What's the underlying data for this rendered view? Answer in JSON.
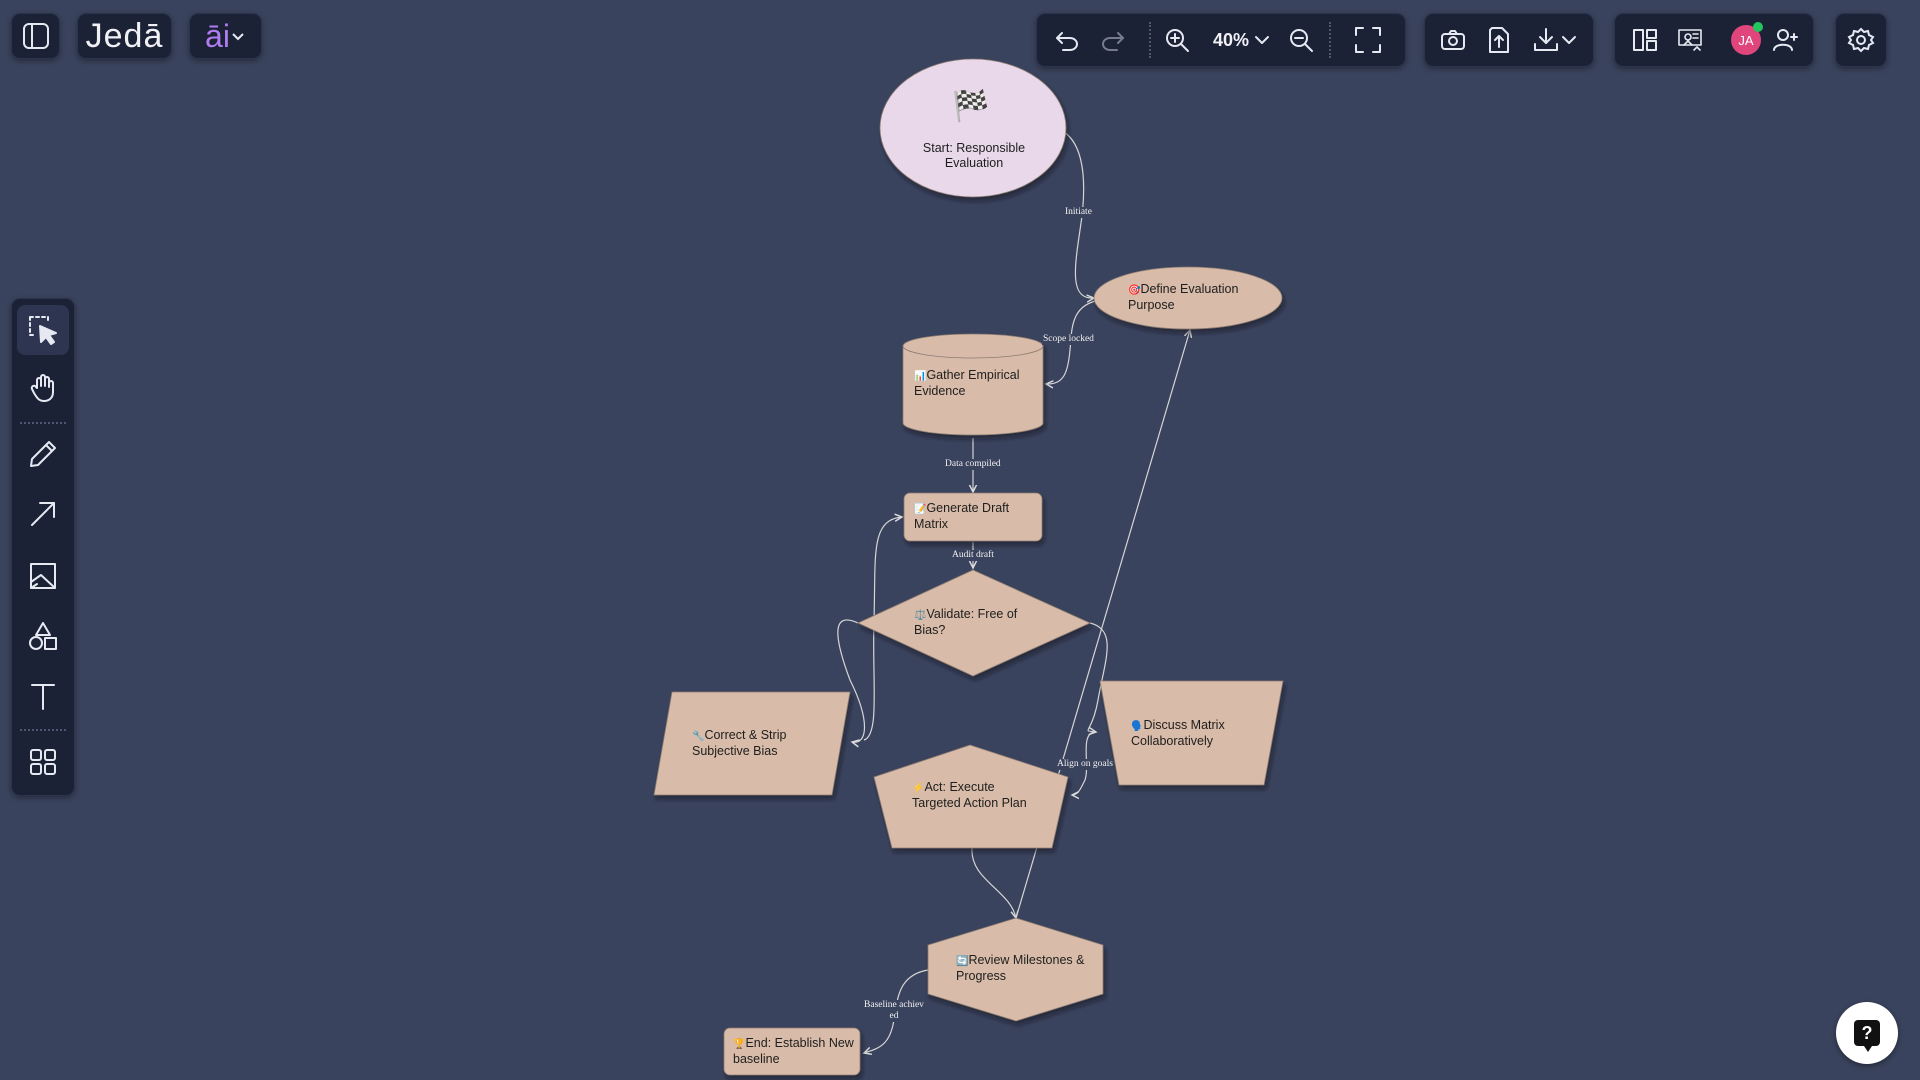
{
  "app": {
    "logo_text": "Jedā",
    "ai_label": "āi",
    "zoom_label": "40%",
    "user_initials": "JA",
    "accent": "#b07cf0",
    "avatar_color": "#e0457b",
    "online_color": "#22c55e"
  },
  "toolbar": {
    "icons": [
      "undo-icon",
      "redo-icon",
      "zoom-in-icon",
      "zoom-dropdown",
      "zoom-out-icon",
      "fullscreen-icon",
      "camera-icon",
      "upload-icon",
      "download-icon",
      "layout-icon",
      "present-icon",
      "add-user-icon",
      "settings-icon"
    ]
  },
  "tools": [
    "select-tool",
    "hand-tool",
    "pen-tool",
    "arrow-tool",
    "image-tool",
    "shapes-tool",
    "text-tool",
    "components-tool"
  ],
  "flowchart": {
    "node_fill": "#d8bba8",
    "start_fill": "#e8d8ea",
    "nodes": {
      "start": {
        "icon": "🏁",
        "text": "Start: Responsible Evaluation"
      },
      "define": {
        "icon": "🎯",
        "text": "Define Evaluation Purpose"
      },
      "gather": {
        "icon": "📊",
        "text": "Gather Empirical Evidence"
      },
      "draft": {
        "icon": "📝",
        "text": "Generate Draft Matrix"
      },
      "validate": {
        "icon": "⚖️",
        "text": "Validate: Free of Bias?"
      },
      "correct": {
        "icon": "🔧",
        "text": "Correct & Strip Subjective Bias"
      },
      "discuss": {
        "icon": "🗣️",
        "text": "Discuss Matrix Collaboratively"
      },
      "act": {
        "icon": "⚡",
        "text": "Act: Execute Targeted Action Plan"
      },
      "review": {
        "icon": "🔄",
        "text": "Review Milestones & Progress"
      },
      "end": {
        "icon": "🏆",
        "text": "End: Establish New baseline"
      }
    },
    "edges": {
      "initiate": "Initiate",
      "scope": "Scope locked",
      "data": "Data compiled",
      "audit": "Audit draft",
      "align": "Align on goals",
      "baseline": "Baseline achiev ed"
    }
  },
  "help_label": "?"
}
